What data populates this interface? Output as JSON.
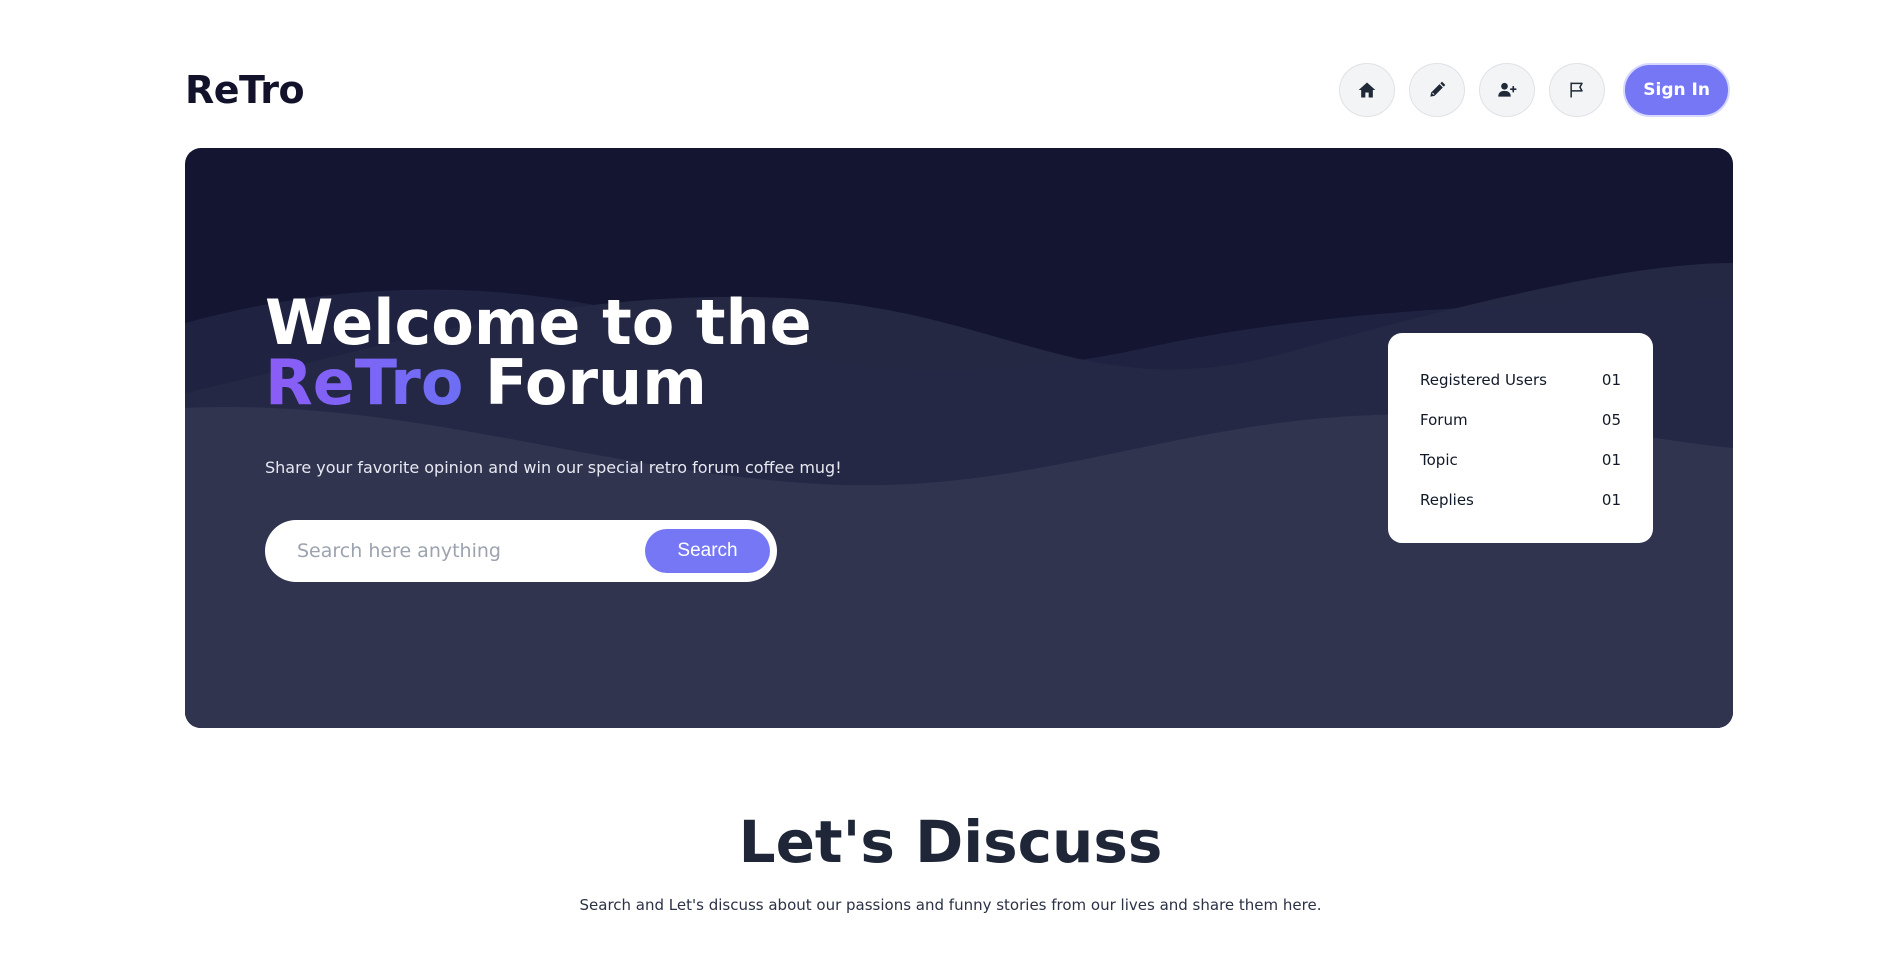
{
  "header": {
    "logo": "ReTro",
    "nav_icons": [
      "home-icon",
      "pencil-icon",
      "user-plus-icon",
      "flag-icon"
    ],
    "signin_label": "Sign In"
  },
  "hero": {
    "title_line1": "Welcome to the",
    "title_accent": "ReTro",
    "title_line2_rest": "Forum",
    "subtitle": "Share your favorite opinion and win our special retro forum coffee mug!",
    "search": {
      "placeholder": "Search here anything",
      "button_label": "Search"
    },
    "stats": [
      {
        "label": "Registered Users",
        "value": "01"
      },
      {
        "label": "Forum",
        "value": "05"
      },
      {
        "label": "Topic",
        "value": "01"
      },
      {
        "label": "Replies",
        "value": "01"
      }
    ]
  },
  "discuss": {
    "title": "Let's Discuss",
    "subtitle": "Search and Let's discuss about our passions and funny stories from our lives and share them here."
  },
  "colors": {
    "accent": "#7577f5",
    "hero_dark": "#131531",
    "hero_mid": "#2a2d4a",
    "title_gradient_start": "#8b5cf6"
  }
}
